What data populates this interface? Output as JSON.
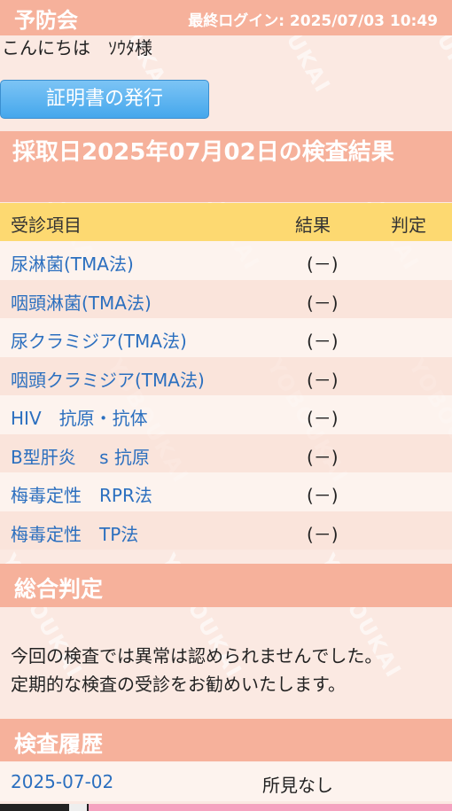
{
  "header": {
    "brand": "予防会",
    "last_login": "最終ログイン: 2025/07/03 10:49"
  },
  "greeting": "こんにちは　ｿｳﾀ様",
  "cert_button_label": "証明書の発行",
  "result_title": "採取日2025年07月02日の検査結果",
  "table": {
    "headers": {
      "item": "受診項目",
      "result": "結果",
      "judgement": "判定"
    },
    "rows": [
      {
        "name": "尿淋菌(TMA法)",
        "result": "(－)",
        "judgement": ""
      },
      {
        "name": "咽頭淋菌(TMA法)",
        "result": "(－)",
        "judgement": ""
      },
      {
        "name": "尿クラミジア(TMA法)",
        "result": "(－)",
        "judgement": ""
      },
      {
        "name": "咽頭クラミジア(TMA法)",
        "result": "(－)",
        "judgement": ""
      },
      {
        "name": "HIV　抗原・抗体",
        "result": "(－)",
        "judgement": ""
      },
      {
        "name": "B型肝炎　 s 抗原",
        "result": "(－)",
        "judgement": ""
      },
      {
        "name": "梅毒定性　RPR法",
        "result": "(－)",
        "judgement": ""
      },
      {
        "name": "梅毒定性　TP法",
        "result": "(－)",
        "judgement": ""
      }
    ]
  },
  "overall": {
    "title": "総合判定",
    "line1": "今回の検査では異常は認められませんでした。",
    "line2": "定期的な検査の受診をお勧めいたします。"
  },
  "history": {
    "title": "検査履歴",
    "entries": [
      {
        "date": "2025-07-02",
        "note": "所見なし"
      }
    ]
  },
  "watermark": "YOBOUKAI",
  "colors": {
    "accent": "#f6b19b",
    "header_row": "#fdd971",
    "button": "#45a7ec",
    "link": "#2b6fbf"
  }
}
